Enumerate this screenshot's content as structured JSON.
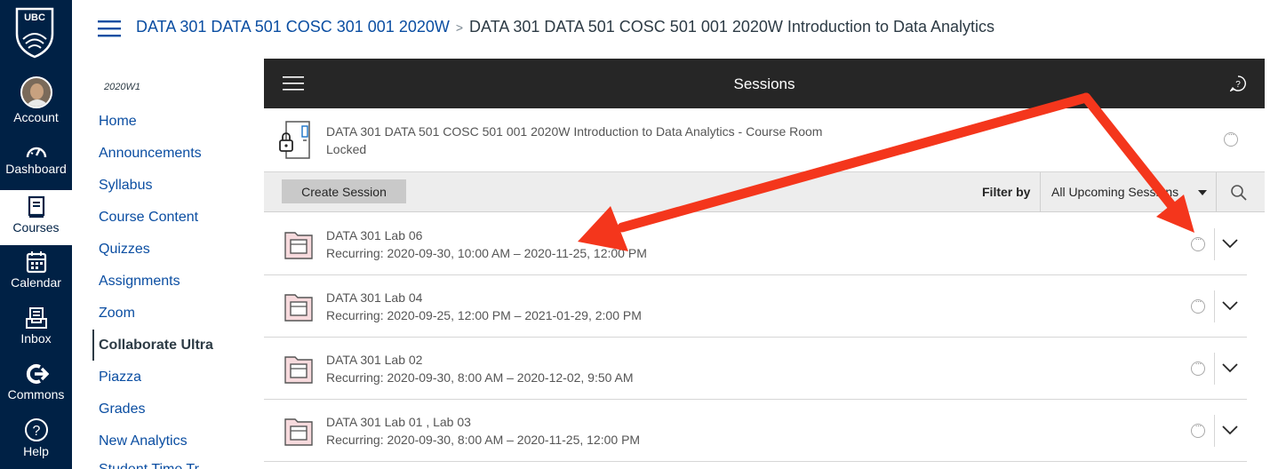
{
  "global_nav": {
    "logo_text": "UBC",
    "items": [
      {
        "label": "Account",
        "icon": "avatar"
      },
      {
        "label": "Dashboard",
        "icon": "dashboard-icon"
      },
      {
        "label": "Courses",
        "icon": "courses-icon"
      },
      {
        "label": "Calendar",
        "icon": "calendar-icon"
      },
      {
        "label": "Inbox",
        "icon": "inbox-icon"
      },
      {
        "label": "Commons",
        "icon": "commons-icon"
      },
      {
        "label": "Help",
        "icon": "help-icon"
      }
    ]
  },
  "breadcrumb": {
    "course": "DATA 301 DATA 501 COSC 301 001 2020W",
    "separator": ">",
    "current": "DATA 301 DATA 501 COSC 501 001 2020W Introduction to Data Analytics"
  },
  "course_nav": {
    "term": "2020W1",
    "items": [
      "Home",
      "Announcements",
      "Syllabus",
      "Course Content",
      "Quizzes",
      "Assignments",
      "Zoom",
      "Collaborate Ultra",
      "Piazza",
      "Grades",
      "New Analytics",
      "Student Time Tr"
    ],
    "active": "Collaborate Ultra"
  },
  "collab": {
    "header_title": "Sessions",
    "course_room": {
      "title": "DATA 301 DATA 501 COSC 501 001 2020W Introduction to Data Analytics - Course Room",
      "status": "Locked"
    },
    "toolbar": {
      "create_label": "Create Session",
      "filter_label": "Filter by",
      "filter_value": "All Upcoming Sessions"
    },
    "sessions": [
      {
        "name": "DATA 301 Lab 06",
        "when": "Recurring: 2020-09-30, 10:00 AM – 2020-11-25, 12:00 PM"
      },
      {
        "name": "DATA 301 Lab 04",
        "when": "Recurring: 2020-09-25, 12:00 PM – 2021-01-29, 2:00 PM"
      },
      {
        "name": "DATA 301 Lab 02",
        "when": "Recurring: 2020-09-30, 8:00 AM – 2020-12-02, 9:50 AM"
      },
      {
        "name": "DATA 301 Lab 01 , Lab 03",
        "when": "Recurring: 2020-09-30, 8:00 AM – 2020-11-25, 12:00 PM"
      }
    ]
  },
  "colors": {
    "global_nav_bg": "#002145",
    "link": "#0b4ea2",
    "collab_header_bg": "#262626",
    "annotation_arrow": "#f4361c"
  }
}
